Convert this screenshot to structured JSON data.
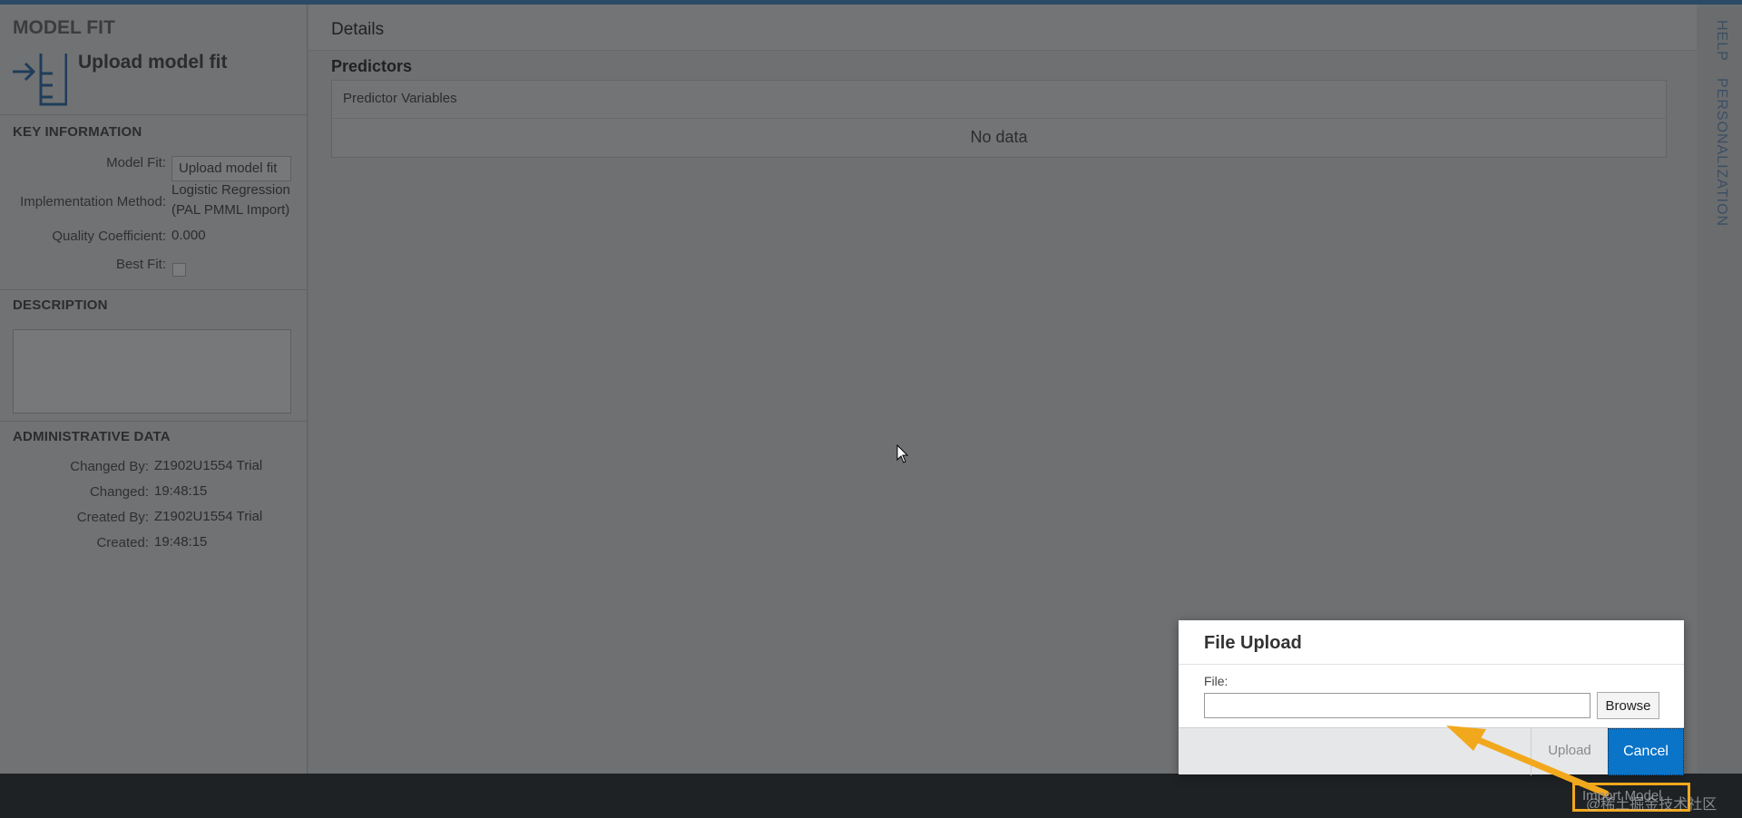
{
  "header": {
    "object_type": "MODEL FIT",
    "object_title": "Upload model fit"
  },
  "key_information": {
    "heading": "KEY INFORMATION",
    "model_fit_label": "Model Fit:",
    "model_fit_value": "Upload model fit",
    "implementation_method_label": "Implementation Method:",
    "implementation_method_line1": "Logistic Regression",
    "implementation_method_line2": "(PAL PMML Import)",
    "quality_coefficient_label": "Quality Coefficient:",
    "quality_coefficient_value": "0.000",
    "best_fit_label": "Best Fit:",
    "best_fit_checked": false
  },
  "description": {
    "heading": "DESCRIPTION",
    "value": ""
  },
  "administrative_data": {
    "heading": "ADMINISTRATIVE DATA",
    "changed_by_label": "Changed By:",
    "changed_by_value": "Z1902U1554 Trial",
    "changed_label": "Changed:",
    "changed_value": "19:48:15",
    "created_by_label": "Created By:",
    "created_by_value": "Z1902U1554 Trial",
    "created_label": "Created:",
    "created_value": "19:48:15"
  },
  "main": {
    "details_title": "Details",
    "predictors_title": "Predictors",
    "table_header": "Predictor Variables",
    "empty_text": "No data"
  },
  "right_rail": {
    "help": "HELP",
    "personalization": "PERSONALIZATION"
  },
  "dialog": {
    "title": "File Upload",
    "file_label": "File:",
    "file_value": "",
    "browse_label": "Browse",
    "upload_label": "Upload",
    "cancel_label": "Cancel"
  },
  "footer": {
    "highlighted_button": "Import Model",
    "watermark": "@稀土掘金技术社区"
  },
  "colors": {
    "accent": "#0a74c8",
    "annotation": "#f2a81d",
    "footer": "#1f2225"
  },
  "icons": {
    "object_icon": "upload-model-icon",
    "cursor": "mouse-cursor-icon",
    "arrow": "annotation-arrow"
  }
}
